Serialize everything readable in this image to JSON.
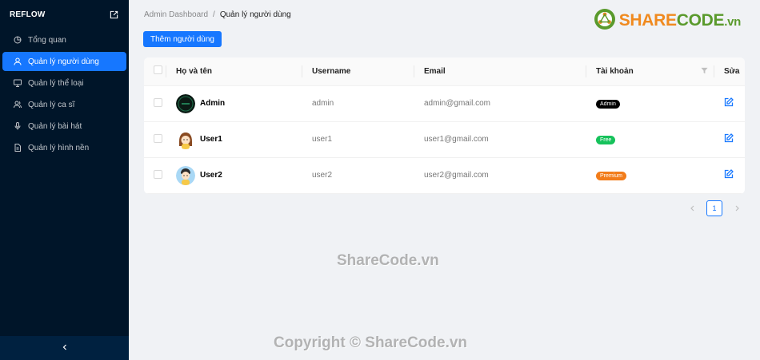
{
  "app": {
    "brand": "REFLOW"
  },
  "sidebar": {
    "items": [
      {
        "label": "Tổng quan",
        "icon": "pie-chart-icon",
        "active": false
      },
      {
        "label": "Quản lý người dùng",
        "icon": "user-icon",
        "active": true
      },
      {
        "label": "Quản lý thể loại",
        "icon": "desktop-icon",
        "active": false
      },
      {
        "label": "Quản lý ca sĩ",
        "icon": "team-icon",
        "active": false
      },
      {
        "label": "Quản lý bài hát",
        "icon": "microphone-icon",
        "active": false
      },
      {
        "label": "Quản lý hình nền",
        "icon": "file-icon",
        "active": false
      }
    ],
    "collapse_icon": "chevron-left-icon"
  },
  "breadcrumb": {
    "root": "Admin Dashboard",
    "separator": "/",
    "current": "Quản lý người dùng"
  },
  "toolbar": {
    "add_label": "Thêm người dùng"
  },
  "watermark": {
    "logo_share": "SHARE",
    "logo_code": "CODE",
    "logo_vn": ".vn",
    "center": "ShareCode.vn",
    "footer": "Copyright © ShareCode.vn"
  },
  "table": {
    "headers": {
      "name": "Họ và tên",
      "username": "Username",
      "email": "Email",
      "account": "Tài khoản",
      "edit": "Sửa"
    },
    "rows": [
      {
        "name": "Admin",
        "username": "admin",
        "email": "admin@gmail.com",
        "account": "Admin",
        "tag_color": "#000000"
      },
      {
        "name": "User1",
        "username": "user1",
        "email": "user1@gmail.com",
        "account": "Free",
        "tag_color": "#16c25b"
      },
      {
        "name": "User2",
        "username": "user2",
        "email": "user2@gmail.com",
        "account": "Premium",
        "tag_color": "#f27c1a"
      }
    ]
  },
  "pagination": {
    "current_page": "1"
  },
  "colors": {
    "primary": "#1677ff",
    "sidebar_bg": "#001529"
  }
}
